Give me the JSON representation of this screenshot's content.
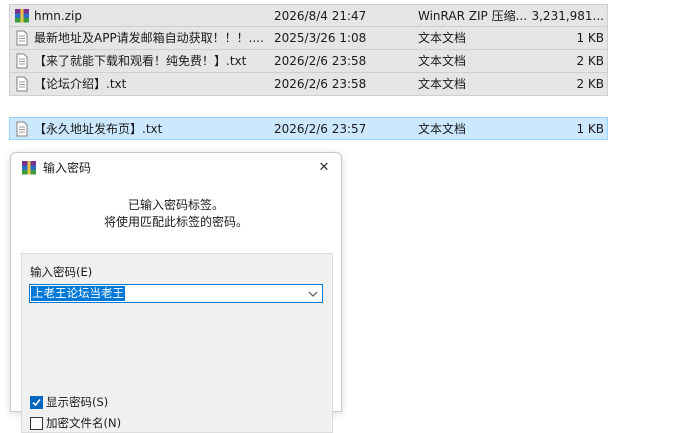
{
  "files": [
    {
      "name": "hmn.zip",
      "date": "2026/8/4 21:47",
      "type": "WinRAR ZIP 压缩...",
      "size": "3,231,981...",
      "icon": "winrar-archive-icon",
      "selected": false
    },
    {
      "name": "最新地址及APP请发邮箱自动获取！！！....",
      "date": "2025/3/26 1:08",
      "type": "文本文档",
      "size": "1 KB",
      "icon": "text-file-icon",
      "selected": false
    },
    {
      "name": "【来了就能下载和观看！纯免费！】.txt",
      "date": "2026/2/6 23:58",
      "type": "文本文档",
      "size": "2 KB",
      "icon": "text-file-icon",
      "selected": false
    },
    {
      "name": "【论坛介绍】.txt",
      "date": "2026/2/6 23:58",
      "type": "文本文档",
      "size": "2 KB",
      "icon": "text-file-icon",
      "selected": false
    },
    {
      "name": "【永久地址发布页】.txt",
      "date": "2026/2/6 23:57",
      "type": "文本文档",
      "size": "1 KB",
      "icon": "text-file-icon",
      "selected": true
    }
  ],
  "dialog": {
    "title": "输入密码",
    "info_line1": "已输入密码标签。",
    "info_line2": "将使用匹配此标签的密码。",
    "password_label": "输入密码(E)",
    "password_value": "上老王论坛当老王",
    "show_password_label": "显示密码(S)",
    "show_password_checked": true,
    "encrypt_names_label": "加密文件名(N)",
    "encrypt_names_checked": false,
    "close_glyph": "✕"
  }
}
